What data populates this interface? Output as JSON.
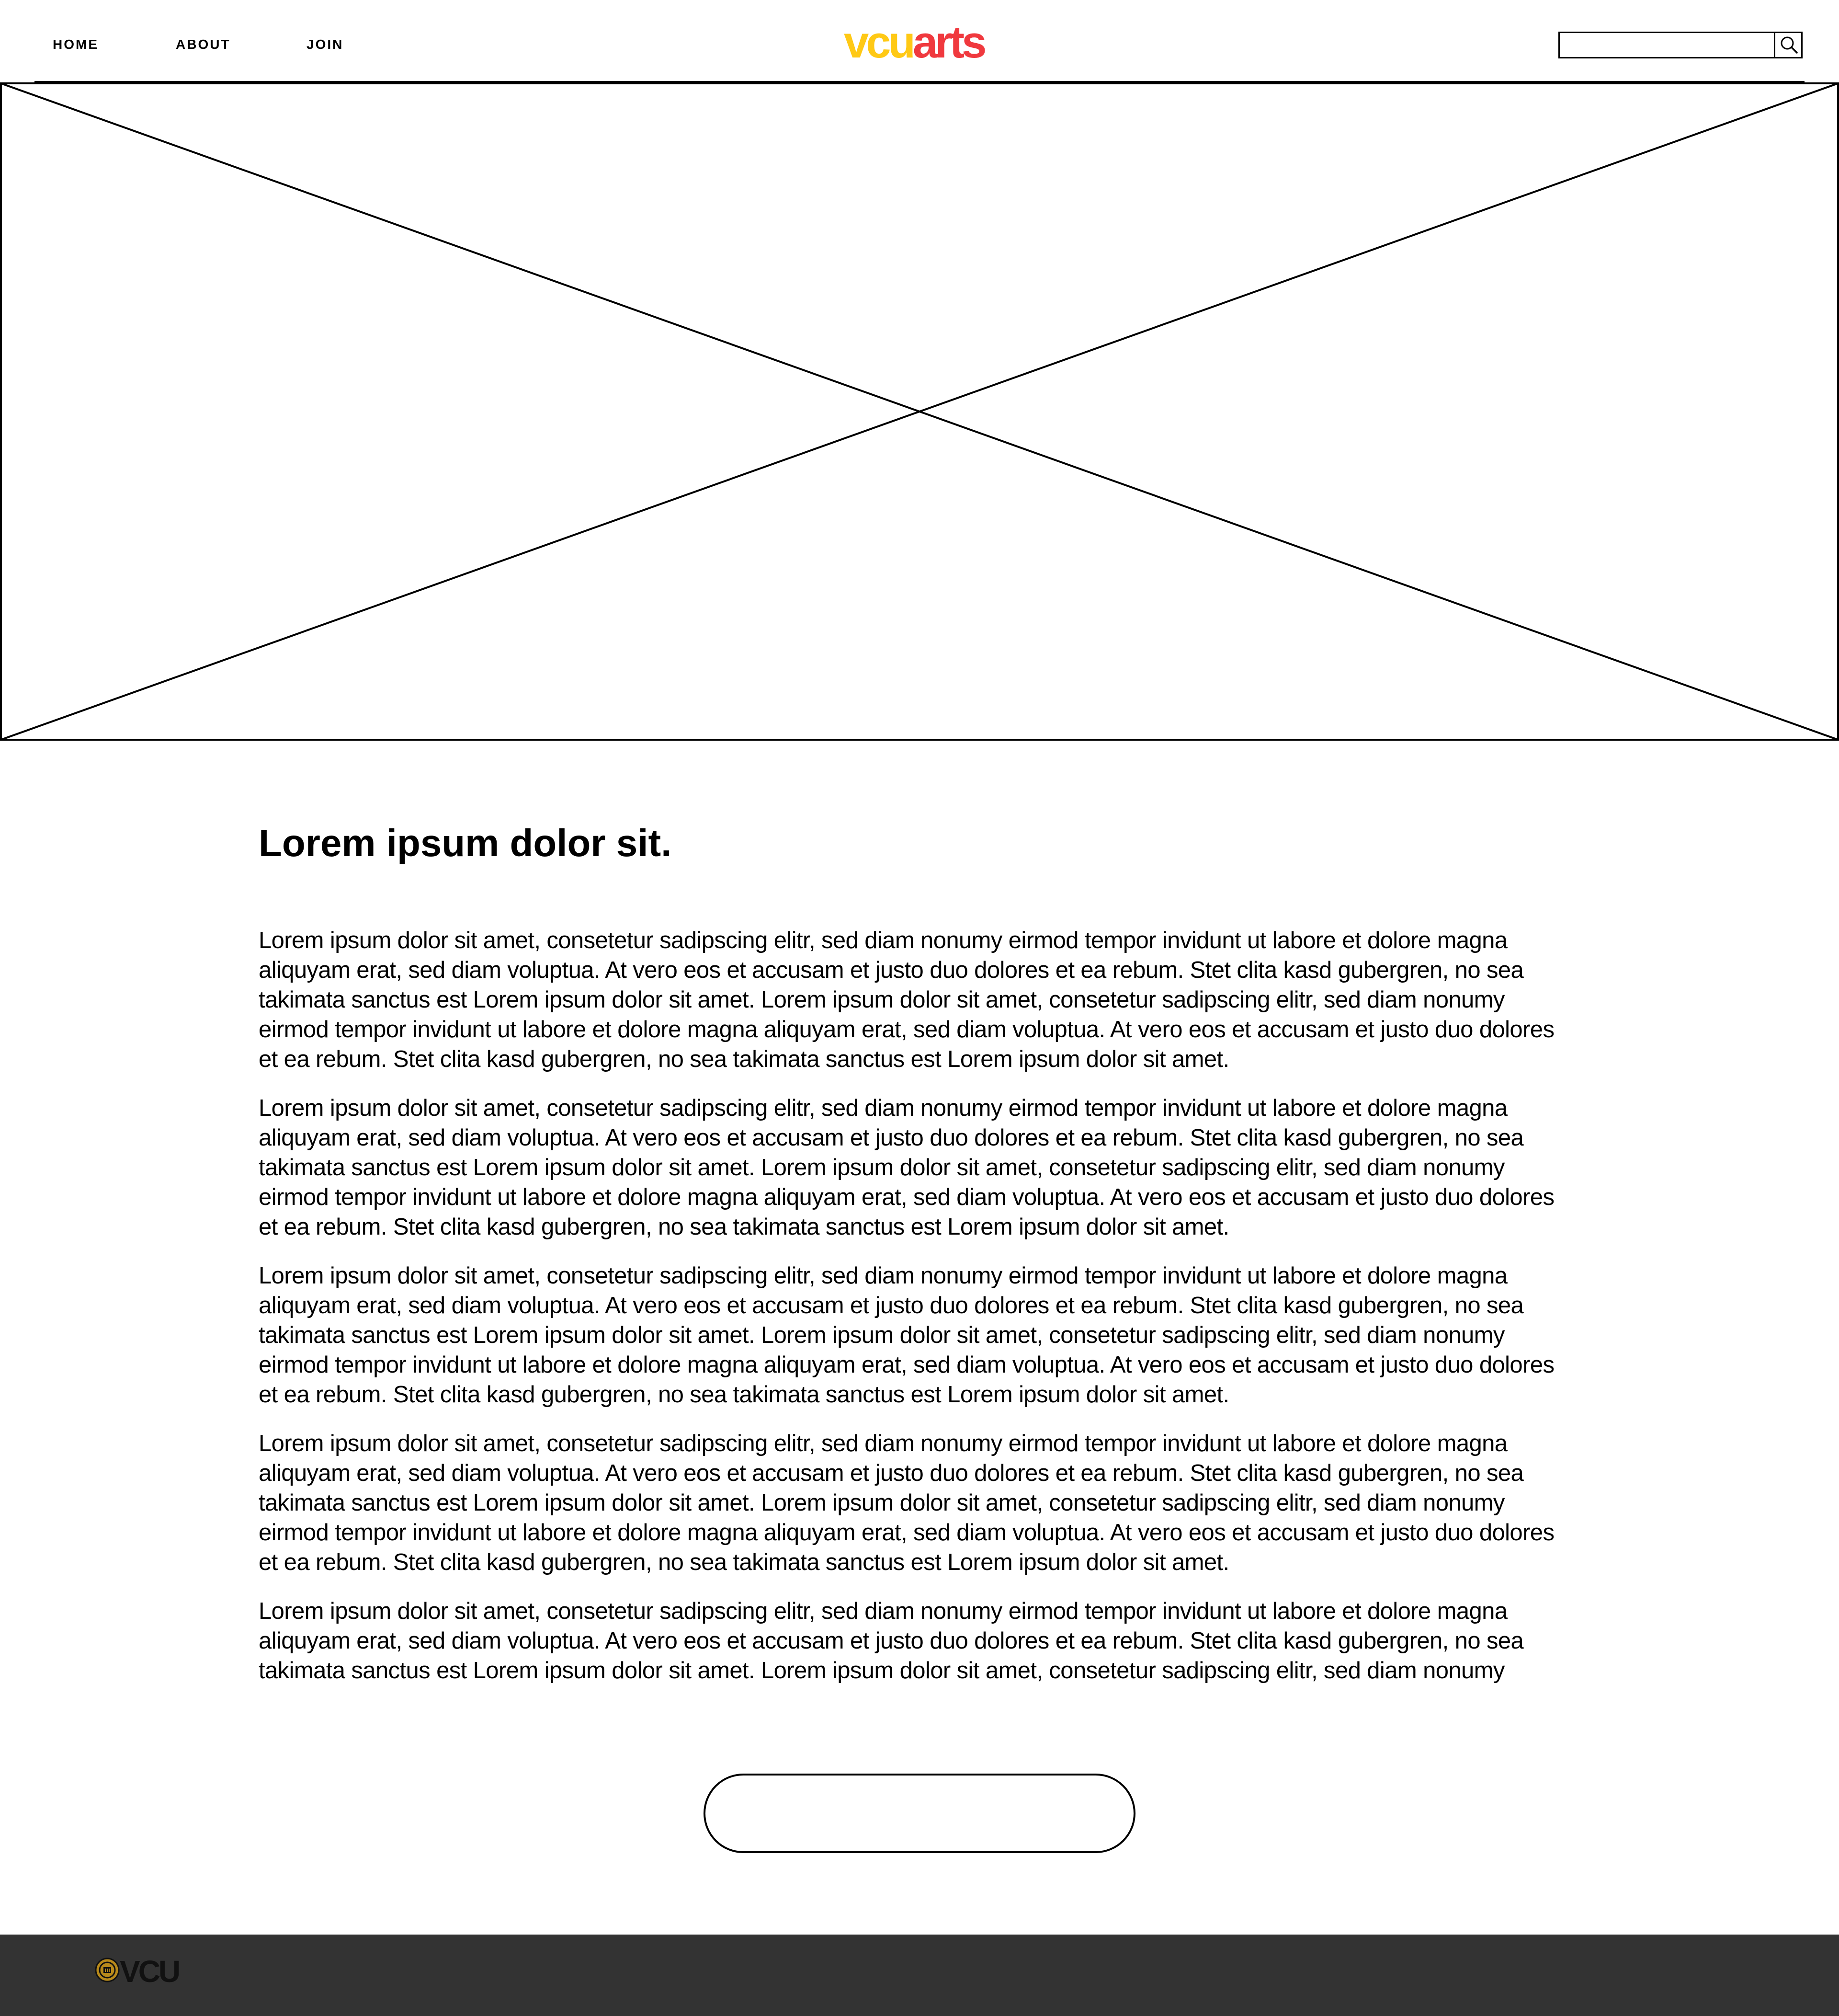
{
  "nav": {
    "items": [
      {
        "label": "HOME"
      },
      {
        "label": "ABOUT"
      },
      {
        "label": "JOIN"
      }
    ]
  },
  "logo": {
    "part1": "vcu",
    "part2": "arts",
    "part1_color": "#FFC915",
    "part2_color": "#F0393E"
  },
  "search": {
    "value": "",
    "placeholder": "",
    "icon": "search-icon"
  },
  "hero": {
    "icon": "image-placeholder-icon"
  },
  "main": {
    "heading": "Lorem ipsum dolor sit.",
    "paragraphs": [
      "Lorem ipsum dolor sit amet, consetetur sadipscing elitr, sed diam nonumy eirmod tempor invidunt ut labore et dolore magna aliquyam erat, sed diam voluptua. At vero eos et accusam et justo duo dolores et ea rebum. Stet clita kasd gubergren, no sea takimata sanctus est Lorem ipsum dolor sit amet. Lorem ipsum dolor sit amet, consetetur sadipscing elitr, sed diam nonumy eirmod tempor invidunt ut labore et dolore magna aliquyam erat, sed diam voluptua. At vero eos et accusam et justo duo dolores et ea rebum. Stet clita kasd gubergren, no sea takimata sanctus est Lorem ipsum dolor sit amet.",
      "Lorem ipsum dolor sit amet, consetetur sadipscing elitr, sed diam nonumy eirmod tempor invidunt ut labore et dolore magna aliquyam erat, sed diam voluptua. At vero eos et accusam et justo duo dolores et ea rebum. Stet clita kasd gubergren, no sea takimata sanctus est Lorem ipsum dolor sit amet. Lorem ipsum dolor sit amet, consetetur sadipscing elitr, sed diam nonumy eirmod tempor invidunt ut labore et dolore magna aliquyam erat, sed diam voluptua. At vero eos et accusam et justo duo dolores et ea rebum. Stet clita kasd gubergren, no sea takimata sanctus est Lorem ipsum dolor sit amet.",
      "Lorem ipsum dolor sit amet, consetetur sadipscing elitr, sed diam nonumy eirmod tempor invidunt ut labore et dolore magna aliquyam erat, sed diam voluptua. At vero eos et accusam et justo duo dolores et ea rebum. Stet clita kasd gubergren, no sea takimata sanctus est Lorem ipsum dolor sit amet. Lorem ipsum dolor sit amet, consetetur sadipscing elitr, sed diam nonumy eirmod tempor invidunt ut labore et dolore magna aliquyam erat, sed diam voluptua. At vero eos et accusam et justo duo dolores et ea rebum. Stet clita kasd gubergren, no sea takimata sanctus est Lorem ipsum dolor sit amet.",
      "Lorem ipsum dolor sit amet, consetetur sadipscing elitr, sed diam nonumy eirmod tempor invidunt ut labore et dolore magna aliquyam erat, sed diam voluptua. At vero eos et accusam et justo duo dolores et ea rebum. Stet clita kasd gubergren, no sea takimata sanctus est Lorem ipsum dolor sit amet. Lorem ipsum dolor sit amet, consetetur sadipscing elitr, sed diam nonumy eirmod tempor invidunt ut labore et dolore magna aliquyam erat, sed diam voluptua. At vero eos et accusam et justo duo dolores et ea rebum. Stet clita kasd gubergren, no sea takimata sanctus est Lorem ipsum dolor sit amet.",
      "Lorem ipsum dolor sit amet, consetetur sadipscing elitr, sed diam nonumy eirmod tempor invidunt ut labore et dolore magna aliquyam erat, sed diam voluptua. At vero eos et accusam et justo duo dolores et ea rebum. Stet clita kasd gubergren, no sea takimata sanctus est Lorem ipsum dolor sit amet. Lorem ipsum dolor sit amet, consetetur sadipscing elitr, sed diam nonumy"
    ]
  },
  "cta": {
    "label": ""
  },
  "footer": {
    "wordmark": "VCU",
    "seal_icon": "vcu-seal-icon",
    "background": "#333333"
  }
}
